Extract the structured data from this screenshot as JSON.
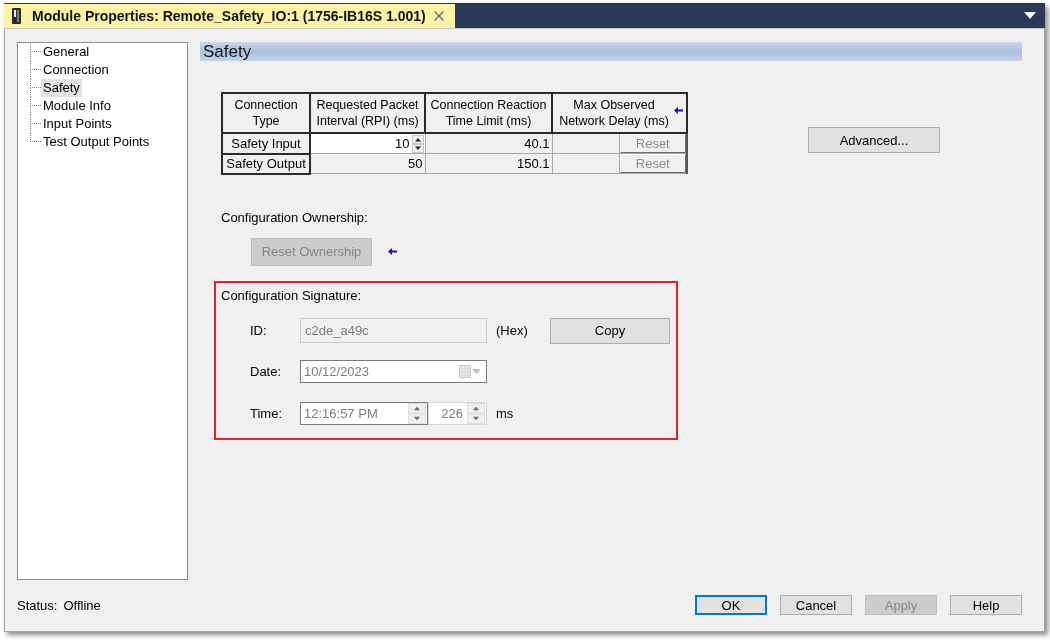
{
  "window": {
    "title": "Module Properties: Remote_Safety_IO:1 (1756-IB16S 1.001)"
  },
  "tree": {
    "items": [
      {
        "label": "General",
        "selected": false
      },
      {
        "label": "Connection",
        "selected": false
      },
      {
        "label": "Safety",
        "selected": true
      },
      {
        "label": "Module Info",
        "selected": false
      },
      {
        "label": "Input Points",
        "selected": false
      },
      {
        "label": "Test Output Points",
        "selected": false
      }
    ]
  },
  "section": {
    "title": "Safety"
  },
  "connections": {
    "columns": [
      "Connection Type",
      "Requested Packet Interval (RPI) (ms)",
      "Connection Reaction Time Limit (ms)",
      "Max Observed Network Delay (ms)"
    ],
    "rows": [
      {
        "connection_type": "Safety Input",
        "rpi": "10",
        "rpi_editable": true,
        "reaction_time_limit": "40.1",
        "reset_button": {
          "label": "Reset",
          "disabled": true
        }
      },
      {
        "connection_type": "Safety Output",
        "rpi": "50",
        "rpi_editable": false,
        "reaction_time_limit": "150.1",
        "reset_button": {
          "label": "Reset",
          "disabled": true
        }
      }
    ]
  },
  "advanced_button": {
    "label": "Advanced...",
    "disabled": false
  },
  "ownership": {
    "label": "Configuration Ownership:",
    "reset_button": {
      "label": "Reset Ownership",
      "disabled": true
    }
  },
  "signature": {
    "label": "Configuration Signature:",
    "highlighted": true,
    "id": {
      "label": "ID:",
      "value": "c2de_a49c",
      "suffix": "(Hex)",
      "disabled": true
    },
    "copy_button": {
      "label": "Copy",
      "disabled": false
    },
    "date": {
      "label": "Date:",
      "value": "10/12/2023",
      "disabled": true
    },
    "time": {
      "label": "Time:",
      "value": "12:16:57 PM",
      "milliseconds": "226",
      "unit": "ms",
      "disabled": true
    }
  },
  "status_bar": {
    "label": "Status:",
    "value": "Offline"
  },
  "buttons": [
    {
      "label": "OK",
      "focused": true,
      "disabled": false
    },
    {
      "label": "Cancel",
      "focused": false,
      "disabled": false
    },
    {
      "label": "Apply",
      "focused": false,
      "disabled": true
    },
    {
      "label": "Help",
      "focused": false,
      "disabled": false
    }
  ]
}
